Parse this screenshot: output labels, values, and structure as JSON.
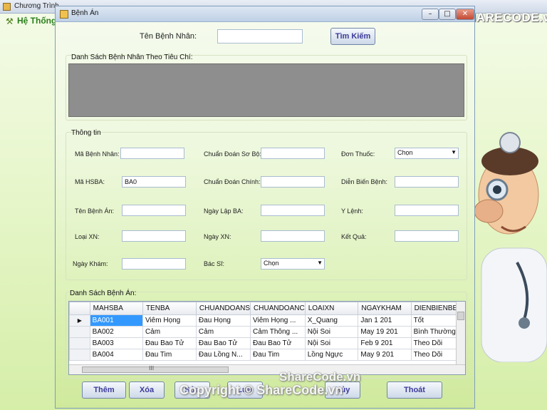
{
  "parent_window": {
    "title": "Chương Trình",
    "menu_label": "Hệ Thống"
  },
  "logo": {
    "text": "SHARECODE.vn"
  },
  "dialog": {
    "title": "Bệnh Án",
    "search": {
      "label": "Tên Bệnh Nhân:",
      "value": "",
      "button": "Tìm Kiếm"
    },
    "patient_list_group": "Danh Sách Bệnh Nhân Theo Tiêu Chí:",
    "info_group": "Thông tin",
    "fields": {
      "ma_benh_nhan": {
        "label": "Mã Bệnh Nhân:",
        "value": ""
      },
      "ma_hsba": {
        "label": "Mã HSBA:",
        "value": "BA0"
      },
      "ten_benh_an": {
        "label": "Tên Bệnh Án:",
        "value": ""
      },
      "loai_xn": {
        "label": "Loại XN:",
        "value": ""
      },
      "ngay_kham": {
        "label": "Ngày Khám:",
        "value": ""
      },
      "chuan_doan_so_bo": {
        "label": "Chuẩn Đoán Sơ Bộ:",
        "value": ""
      },
      "chuan_doan_chinh": {
        "label": "Chuẩn Đoán Chính:",
        "value": ""
      },
      "ngay_lap_ba": {
        "label": "Ngày Lập BA:",
        "value": ""
      },
      "ngay_xn": {
        "label": "Ngày XN:",
        "value": ""
      },
      "bac_si": {
        "label": "Bác Sĩ:",
        "value": "Chọn"
      },
      "don_thuoc": {
        "label": "Đơn Thuốc:",
        "value": "Chọn"
      },
      "dien_bien_benh": {
        "label": "Diễn Biến Bệnh:",
        "value": ""
      },
      "y_lenh": {
        "label": "Y Lệnh:",
        "value": ""
      },
      "ket_qua": {
        "label": "Kết Quả:",
        "value": ""
      }
    },
    "records_group": "Danh Sách Bệnh Án:",
    "grid": {
      "columns": [
        "MAHSBA",
        "TENBA",
        "CHUANDOANS",
        "CHUANDOANC",
        "LOAIXN",
        "NGAYKHAM",
        "DIENBIENBE"
      ],
      "rows": [
        [
          "BA001",
          "Viêm Họng",
          "Đau Họng",
          "Viêm Họng ...",
          "X_Quang",
          "Jan 1 201",
          "Tốt"
        ],
        [
          "BA002",
          "Cảm",
          "Cảm",
          "Cảm Thông ...",
          "Nội Soi",
          "May 19 201",
          "Bình Thường"
        ],
        [
          "BA003",
          "Đau Bao Tử",
          "Đau Bao Tử",
          "Đau Bao Tử",
          "Nội Soi",
          "Feb 9 201",
          "Theo Dõi"
        ],
        [
          "BA004",
          "Đau Tim",
          "Đau Lồng N...",
          "Đau Tim",
          "Lồng Ngực",
          "May 9 201",
          "Theo Dõi"
        ]
      ],
      "hscroll_label": "III"
    },
    "buttons": {
      "add": "Thêm",
      "delete": "Xóa",
      "edit": "Sửa",
      "save": "Lưu",
      "cancel": "Hủy",
      "exit": "Thoát"
    }
  },
  "watermark": {
    "line1": "ShareCode.vn",
    "line2": "Copyright © ShareCode.vn"
  }
}
